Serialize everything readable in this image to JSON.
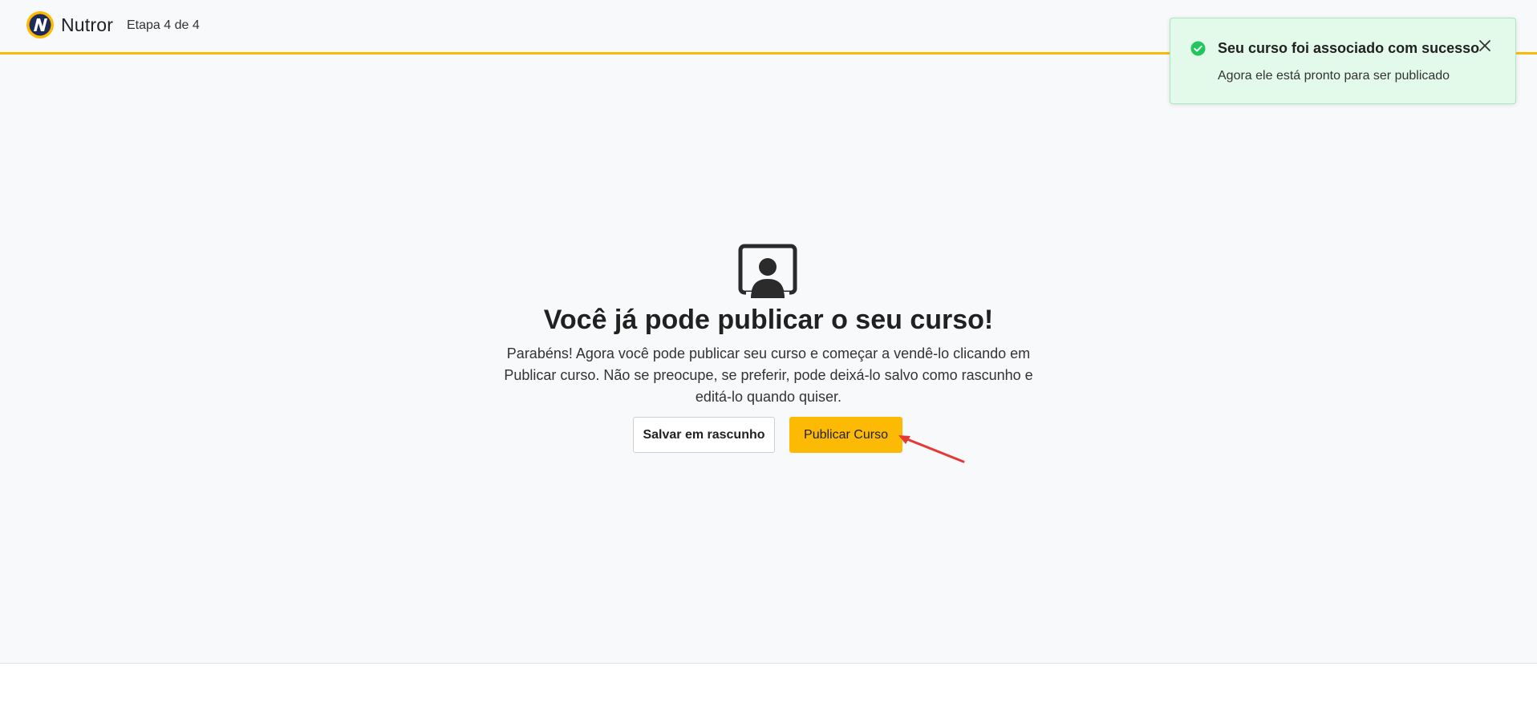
{
  "header": {
    "brand": "Nutror",
    "step": "Etapa 4 de 4"
  },
  "toast": {
    "title": "Seu curso foi associado com sucesso",
    "message": "Agora ele está pronto para ser publicado",
    "icon": "check-circle-icon",
    "close_icon": "close-icon"
  },
  "main": {
    "icon": "presentation-user-icon",
    "title": "Você já pode publicar o seu curso!",
    "description": "Parabéns! Agora você pode publicar seu curso e começar a vendê-lo clicando em Publicar curso. Não se preocupe, se preferir, pode deixá-lo salvo como rascunho e editá-lo quando quiser.",
    "draft_button": "Salvar em rascunho",
    "publish_button": "Publicar Curso"
  },
  "colors": {
    "accent": "#fcba05",
    "success_bg": "#e3faeb",
    "success_icon": "#22c55e",
    "annotation_arrow": "#e53935"
  }
}
